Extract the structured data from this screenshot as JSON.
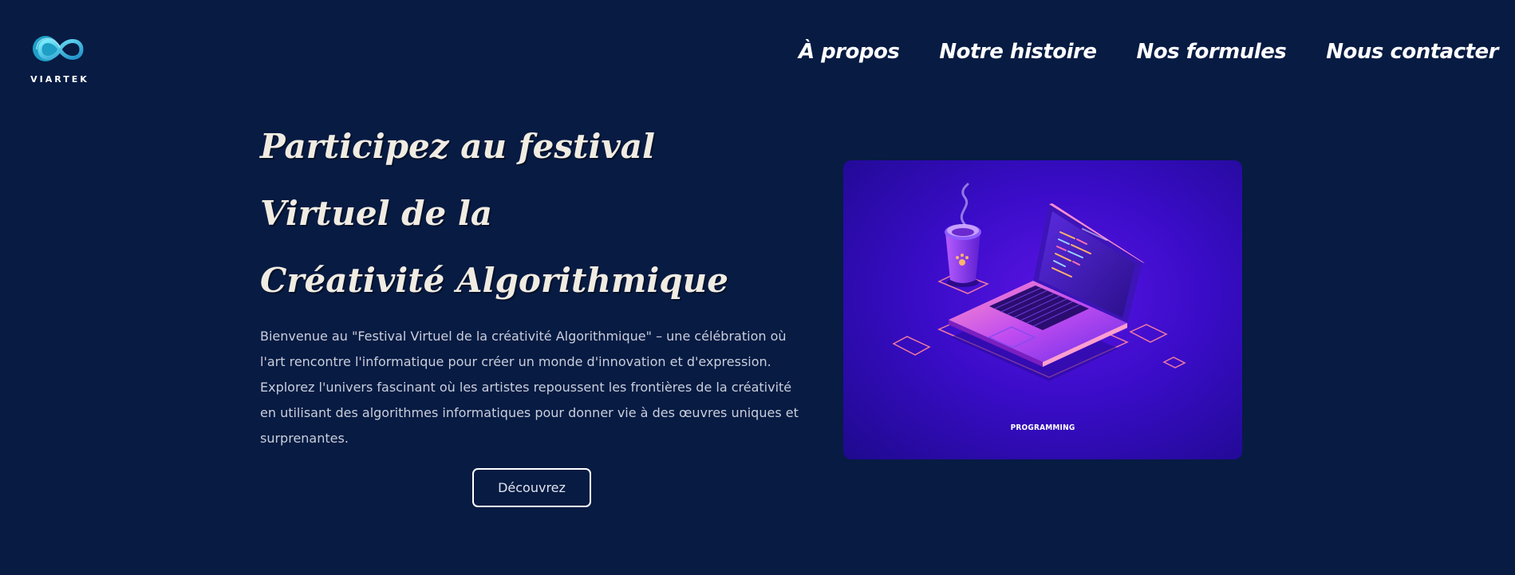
{
  "header": {
    "logo_text": "VIARTEK",
    "nav": [
      {
        "label": "À propos"
      },
      {
        "label": "Notre histoire"
      },
      {
        "label": "Nos formules"
      },
      {
        "label": "Nous contacter"
      }
    ]
  },
  "hero": {
    "title_lines": [
      "Participez au festival",
      "Virtuel de la",
      "Créativité Algorithmique"
    ],
    "description": "Bienvenue au \"Festival Virtuel de la créativité Algorithmique\" – une célébration où l'art rencontre l'informatique pour créer un monde d'innovation et d'expression. Explorez l'univers fascinant où les artistes repoussent les frontières de la créativité en utilisant des algorithmes informatiques pour donner vie à des œuvres uniques et surprenantes.",
    "cta_label": "Découvrez",
    "illustration_caption": "PROGRAMMING"
  },
  "colors": {
    "background": "#071b43",
    "title": "#f1ece2",
    "illustration_bg": "#3a0cc8",
    "logo_accent": "#3fd0e8"
  }
}
